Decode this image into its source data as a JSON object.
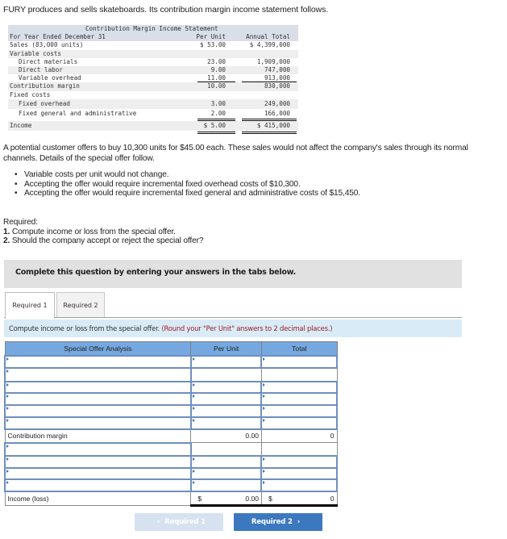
{
  "intro": "FURY produces and sells skateboards. Its contribution margin income statement follows.",
  "statement": {
    "title": "Contribution Margin Income Statement",
    "period_label": "For Year Ended December 31",
    "col_per_unit": "Per Unit",
    "col_annual_total": "Annual Total",
    "rows": [
      {
        "label": "Sales (83,000 units)",
        "per_unit": "$ 53.00",
        "annual_total": "$ 4,399,000"
      },
      {
        "label": "Variable costs",
        "per_unit": "",
        "annual_total": ""
      },
      {
        "label": "Direct materials",
        "per_unit": "23.00",
        "annual_total": "1,909,000"
      },
      {
        "label": "Direct labor",
        "per_unit": "9.00",
        "annual_total": "747,000"
      },
      {
        "label": "Variable overhead",
        "per_unit": "11.00",
        "annual_total": "913,000"
      },
      {
        "label": "Contribution margin",
        "per_unit": "10.00",
        "annual_total": "830,000"
      },
      {
        "label": "Fixed costs",
        "per_unit": "",
        "annual_total": ""
      },
      {
        "label": "Fixed overhead",
        "per_unit": "3.00",
        "annual_total": "249,000"
      },
      {
        "label": "Fixed general and administrative",
        "per_unit": "2.00",
        "annual_total": "166,000"
      },
      {
        "label": "Income",
        "per_unit": "$ 5.00",
        "annual_total": "$ 415,000"
      }
    ]
  },
  "offer_paragraph": "A potential customer offers to buy 10,300 units for $45.00 each. These sales would not affect the company's sales through its normal channels. Details of the special offer follow.",
  "bullets": [
    "Variable costs per unit would not change.",
    "Accepting the offer would require incremental fixed overhead costs of $10,300.",
    "Accepting the offer would require incremental fixed general and administrative costs of $15,450."
  ],
  "required": {
    "heading": "Required:",
    "items": [
      {
        "num": "1.",
        "text": " Compute income or loss from the special offer."
      },
      {
        "num": "2.",
        "text": " Should the company accept or reject the special offer?"
      }
    ]
  },
  "instruction_box": "Complete this question by entering your answers in the tabs below.",
  "tabs": [
    {
      "label": "Required 1",
      "active": true
    },
    {
      "label": "Required 2",
      "active": false
    }
  ],
  "tab_instruction": {
    "text": "Compute income or loss from the special offer.",
    "note": "(Round your \"Per Unit\" answers to 2 decimal places.)"
  },
  "analysis_table": {
    "headers": [
      "Special Offer Analysis",
      "Per Unit",
      "Total"
    ],
    "contribution_margin": {
      "label": "Contribution margin",
      "per_unit": "0.00",
      "total": "0"
    },
    "income": {
      "label": "Income (loss)",
      "currency": "$",
      "per_unit": "0.00",
      "total": "0"
    }
  },
  "nav": {
    "prev_label": "Required 1",
    "next_label": "Required 2",
    "prev_icon": "‹",
    "next_icon": "›"
  },
  "colors": {
    "table_header": "#75a8e0",
    "next_button": "#3c78bf",
    "prev_button_disabled": "#d6e2f0",
    "note_red": "#9b1b1b",
    "instruction_bar": "#d9ebf7"
  }
}
